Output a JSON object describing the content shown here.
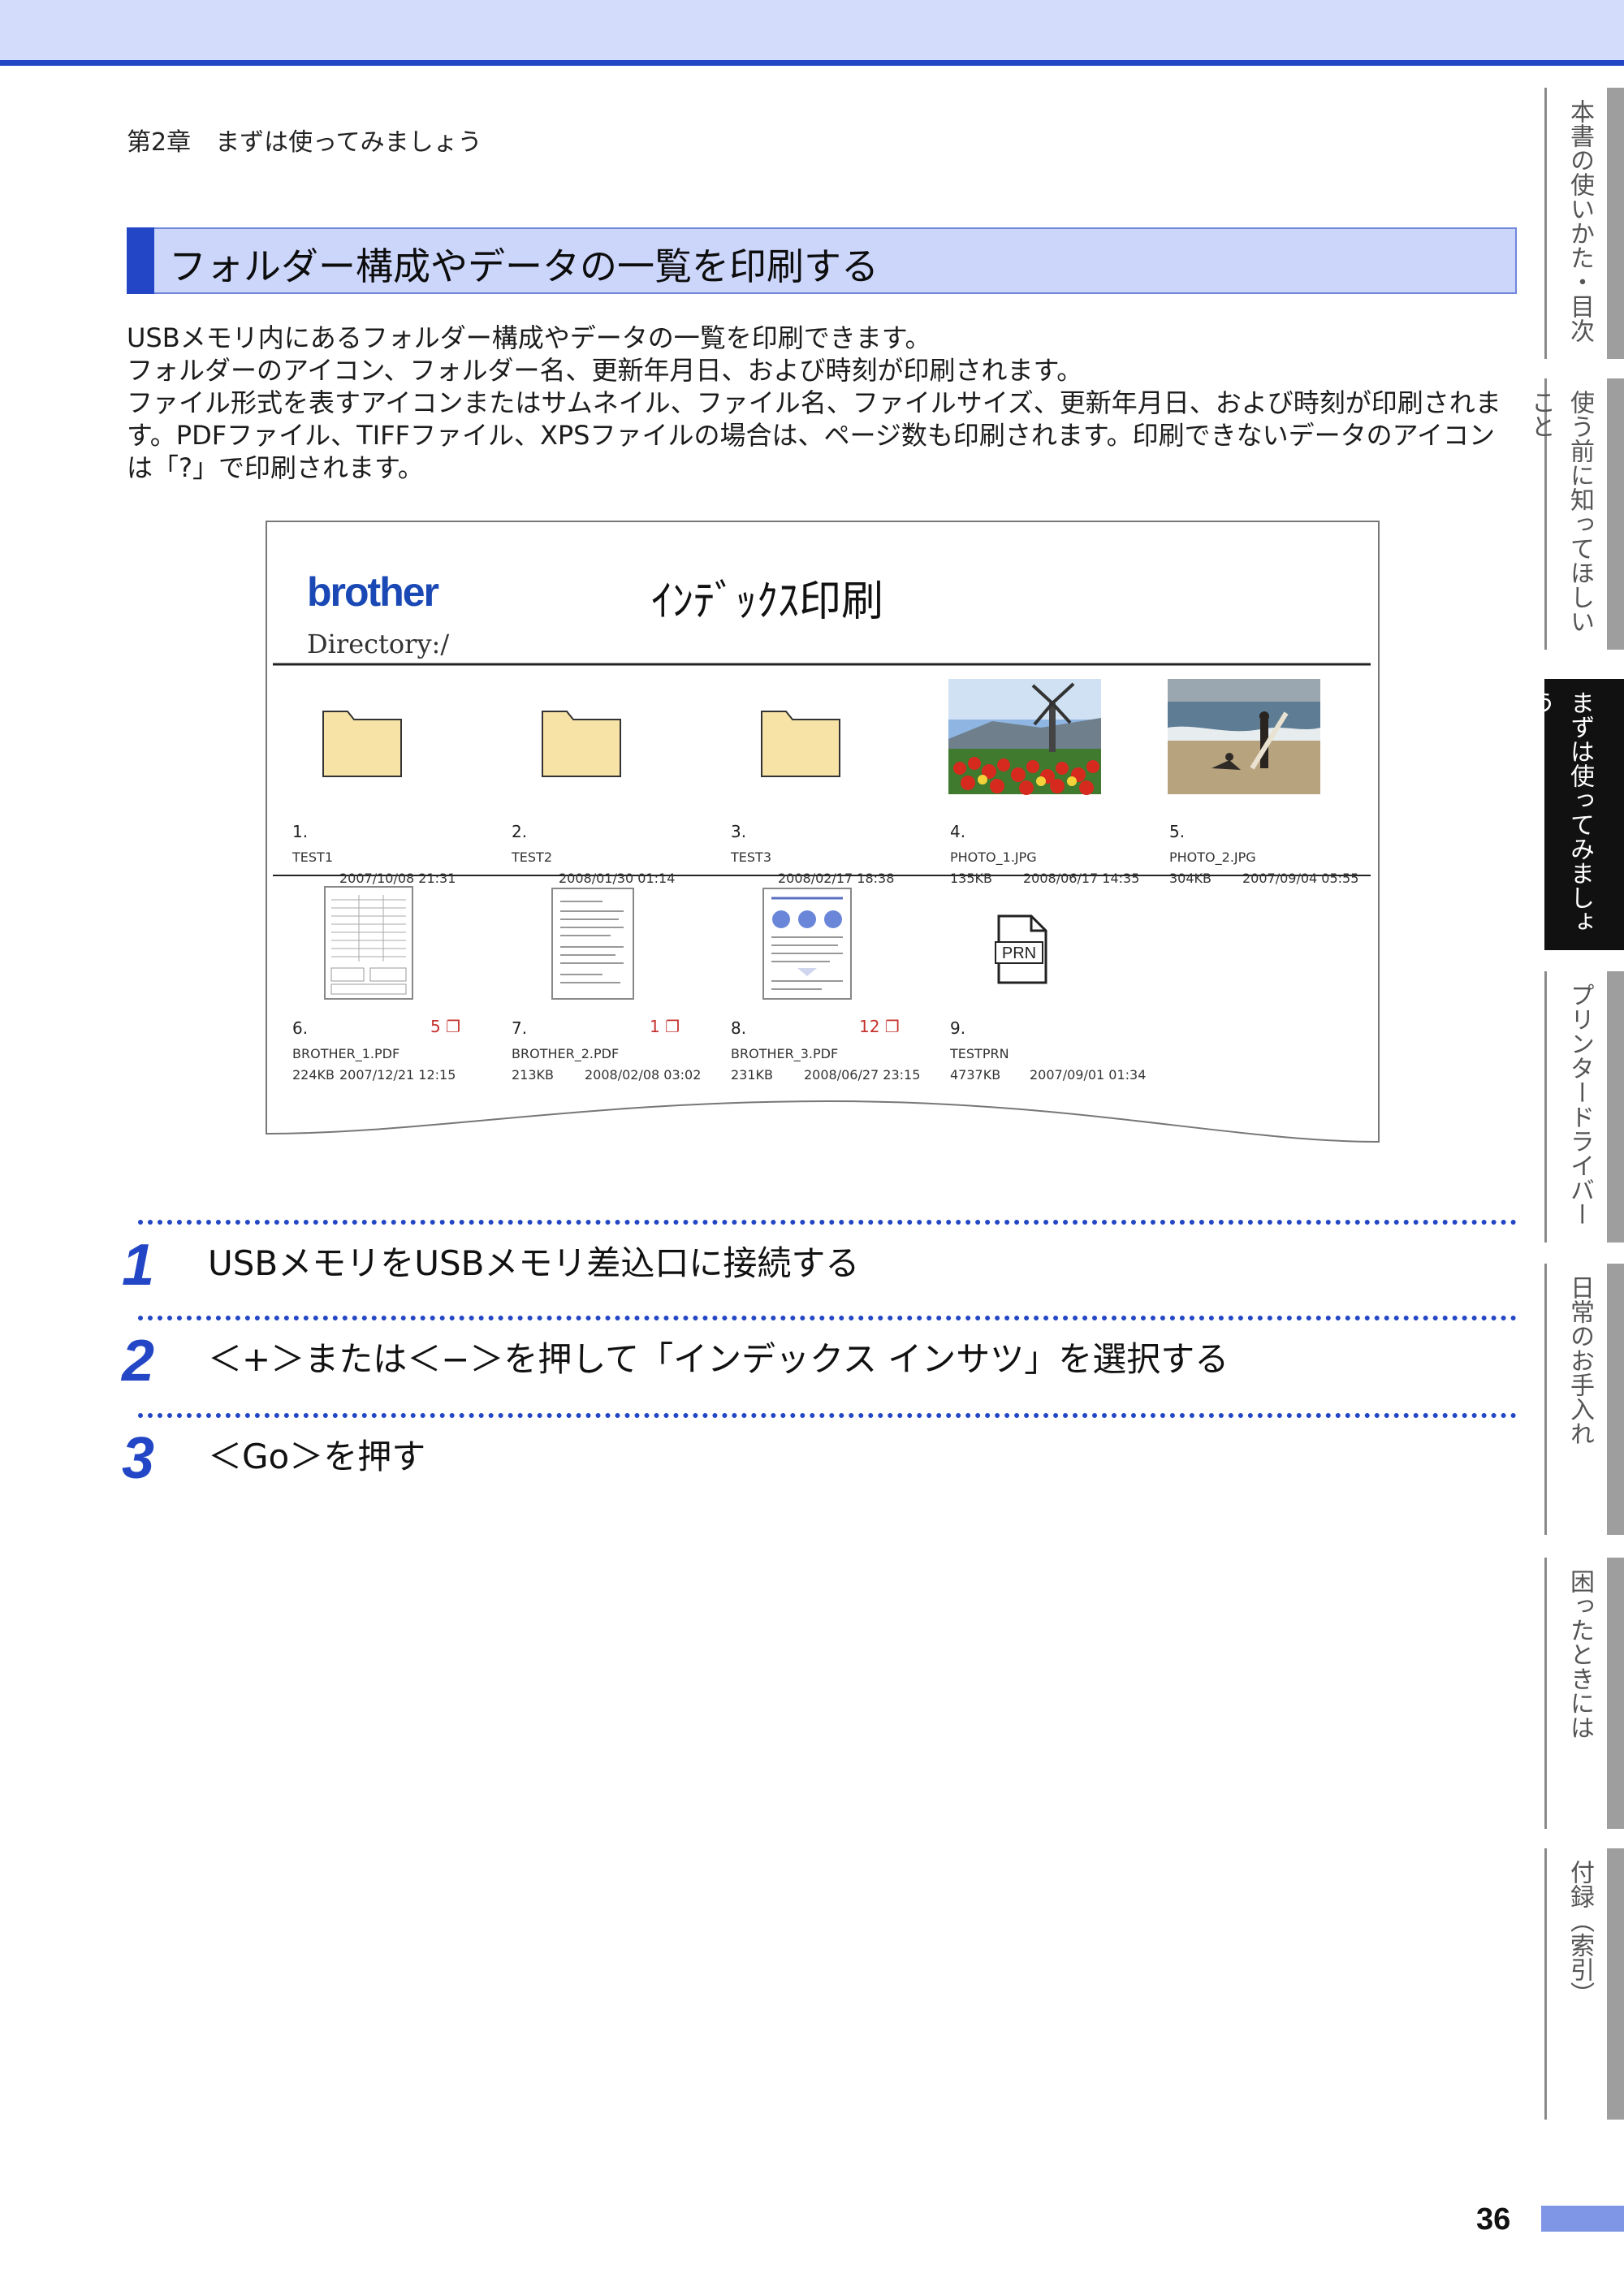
{
  "header": {
    "chapter": "第2章　まずは使ってみましょう"
  },
  "section": {
    "title": "フォルダー構成やデータの一覧を印刷する"
  },
  "intro": [
    "USBメモリ内にあるフォルダー構成やデータの一覧を印刷できます。",
    "フォルダーのアイコン、フォルダー名、更新年月日、および時刻が印刷されます。",
    "ファイル形式を表すアイコンまたはサムネイル、ファイル名、ファイルサイズ、更新年月日、および時刻が印刷されます。PDFファイル、TIFFファイル、XPSファイルの場合は、ページ数も印刷されます。印刷できないデータのアイコンは「?」で印刷されます。"
  ],
  "sample": {
    "logo": "brother",
    "title": "ｲﾝﾃﾞｯｸｽ印刷",
    "directory": "Directory:/",
    "items": [
      {
        "num": "1.",
        "name": "TEST1",
        "size": "",
        "datetime": "2007/10/08 21:31",
        "pages": "",
        "kind": "folder"
      },
      {
        "num": "2.",
        "name": "TEST2",
        "size": "",
        "datetime": "2008/01/30 01:14",
        "pages": "",
        "kind": "folder"
      },
      {
        "num": "3.",
        "name": "TEST3",
        "size": "",
        "datetime": "2008/02/17 18:38",
        "pages": "",
        "kind": "folder"
      },
      {
        "num": "4.",
        "name": "PHOTO_1.JPG",
        "size": "135KB",
        "datetime": "2008/06/17 14:35",
        "pages": "",
        "kind": "photo-tulips"
      },
      {
        "num": "5.",
        "name": "PHOTO_2.JPG",
        "size": "304KB",
        "datetime": "2007/09/04 05:55",
        "pages": "",
        "kind": "photo-beach"
      },
      {
        "num": "6.",
        "name": "BROTHER_1.PDF",
        "size": "224KB",
        "datetime": "2007/12/21 12:15",
        "pages": "5",
        "kind": "pdf-form"
      },
      {
        "num": "7.",
        "name": "BROTHER_2.PDF",
        "size": "213KB",
        "datetime": "2008/02/08 03:02",
        "pages": "1",
        "kind": "pdf-text"
      },
      {
        "num": "8.",
        "name": "BROTHER_3.PDF",
        "size": "231KB",
        "datetime": "2008/06/27 23:15",
        "pages": "12",
        "kind": "pdf-flyer"
      },
      {
        "num": "9.",
        "name": "TESTPRN",
        "size": "4737KB",
        "datetime": "2007/09/01 01:34",
        "pages": "",
        "kind": "prn"
      }
    ],
    "prn_label": "PRN"
  },
  "steps": [
    {
      "num": "1",
      "text": "USBメモリをUSBメモリ差込口に接続する"
    },
    {
      "num": "2",
      "text": "＜+＞または＜−＞を押して「インデックス インサツ」を選択する"
    },
    {
      "num": "3",
      "text": "＜Go＞を押す"
    }
  ],
  "side_tabs": [
    {
      "label": "本書の使いかた・目次",
      "active": false
    },
    {
      "label": "使う前に知ってほしいこと",
      "active": false
    },
    {
      "label": "まずは使ってみましょう",
      "active": true
    },
    {
      "label": "プリンタードライバー",
      "active": false
    },
    {
      "label": "日常のお手入れ",
      "active": false
    },
    {
      "label": "困ったときには",
      "active": false
    },
    {
      "label": "付録（索引）",
      "active": false
    }
  ],
  "page_number": "36"
}
